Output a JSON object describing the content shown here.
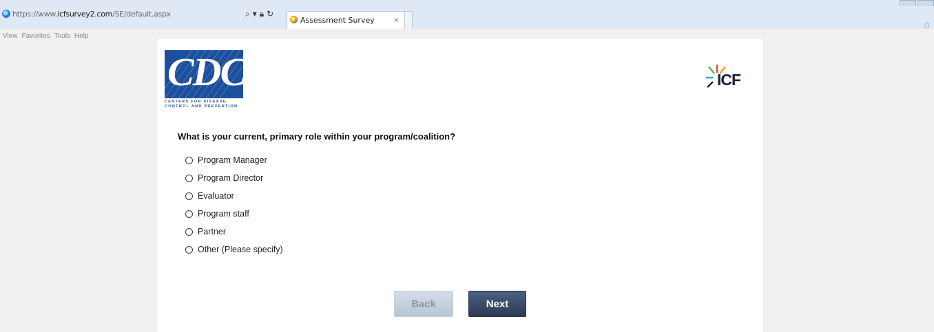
{
  "browser": {
    "url_prefix": "https://www.",
    "url_host": "icfsurvey2.com",
    "url_path": "/SE/default.aspx",
    "tab_title": "Assessment Survey",
    "tab_close": "×",
    "menu": [
      "View",
      "Favorites",
      "Tools",
      "Help"
    ]
  },
  "header": {
    "cdc_letters": "CDC",
    "cdc_sub_line1": "CENTERS FOR DISEASE",
    "cdc_sub_line2": "CONTROL AND PREVENTION",
    "icf_text": "ICF"
  },
  "survey": {
    "question": "What is your current, primary role within your program/coalition?",
    "options": [
      "Program Manager",
      "Program Director",
      "Evaluator",
      "Program staff",
      "Partner",
      "Other (Please specify)"
    ]
  },
  "buttons": {
    "back": "Back",
    "next": "Next"
  },
  "colors": {
    "cdc_blue": "#1c4f9c",
    "next_button": "#2c3a56",
    "back_button": "#b8c6d6"
  }
}
